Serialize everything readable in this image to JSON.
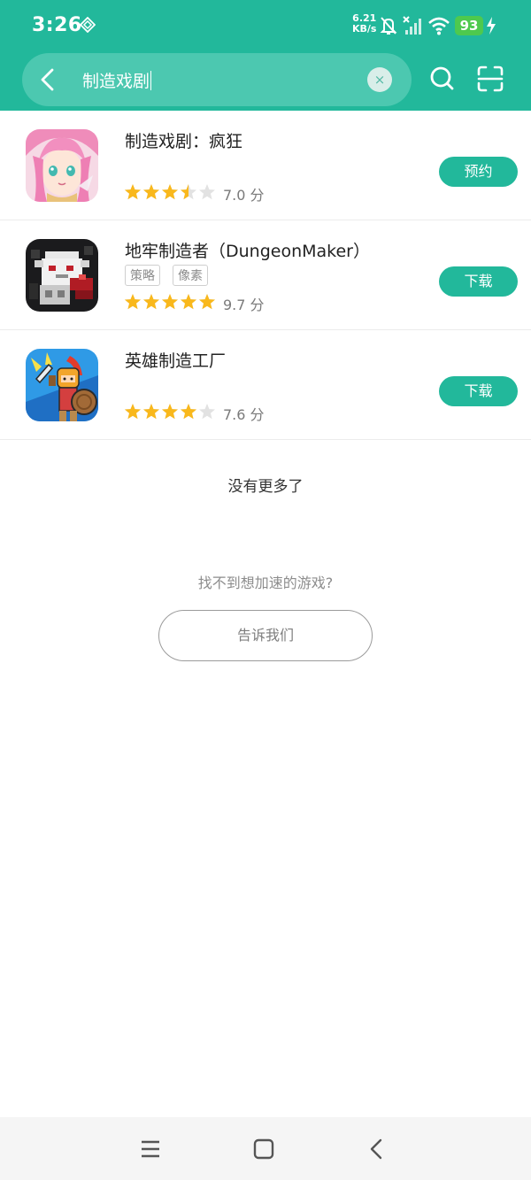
{
  "status_bar": {
    "time": "3:26",
    "net_speed_value": "6.21",
    "net_speed_unit": "KB/s",
    "battery": "93",
    "icons": [
      "diamond-icon",
      "bell-off-icon",
      "signal-off-icon",
      "wifi-icon",
      "battery-icon",
      "charging-icon"
    ]
  },
  "search": {
    "query": "制造戏剧",
    "clear_label": "×"
  },
  "header_icons": [
    "back-icon",
    "search-icon",
    "scan-icon"
  ],
  "results": [
    {
      "title": "制造戏剧：疯狂",
      "tags": [],
      "rating": 3.5,
      "score": "7.0 分",
      "action": "预约"
    },
    {
      "title": "地牢制造者（DungeonMaker）",
      "tags": [
        "策略",
        "像素"
      ],
      "rating": 5,
      "score": "9.7 分",
      "action": "下载"
    },
    {
      "title": "英雄制造工厂",
      "tags": [],
      "rating": 4,
      "score": "7.6 分",
      "action": "下载"
    }
  ],
  "footer": {
    "no_more": "没有更多了",
    "prompt": "找不到想加速的游戏?",
    "tell_us": "告诉我们"
  },
  "nav_bar": [
    "menu-icon",
    "home-icon",
    "back-icon"
  ],
  "colors": {
    "accent": "#22b89b",
    "star": "#f9b81c",
    "star_empty": "#e2e2e2"
  }
}
